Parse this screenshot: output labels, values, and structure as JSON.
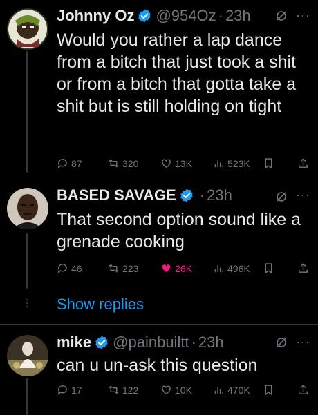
{
  "tweets": [
    {
      "name": "Johnny Oz",
      "handle": "@954Oz",
      "dot": "·",
      "time": "23h",
      "text": "Would you rather a lap dance from a bitch that just took a shit or from a bitch that gotta take a shit but is still holding on tight",
      "replies": "87",
      "retweets": "320",
      "likes": "13K",
      "views": "523K"
    },
    {
      "name": "BASED SAVAGE",
      "handle": "",
      "dot": "·",
      "time": "23h",
      "text": "That second option sound like a grenade cooking",
      "replies": "46",
      "retweets": "223",
      "likes": "26K",
      "views": "496K",
      "liked": true
    },
    {
      "name": "mike",
      "handle": "@painbuiltt",
      "dot": "·",
      "time": "23h",
      "text": "can u un-ask this question",
      "replies": "17",
      "retweets": "122",
      "likes": "10K",
      "views": "470K"
    }
  ],
  "show_replies": "Show replies",
  "more_glyph": "···",
  "colors": {
    "accent": "#1d9bf0",
    "like": "#f91880",
    "muted": "#71767b",
    "text": "#e7e9ea",
    "background": "#000000"
  },
  "icons": [
    "verified-badge-icon",
    "grok-icon",
    "more-icon",
    "reply-icon",
    "retweet-icon",
    "like-icon",
    "views-icon",
    "bookmark-icon",
    "share-icon"
  ]
}
